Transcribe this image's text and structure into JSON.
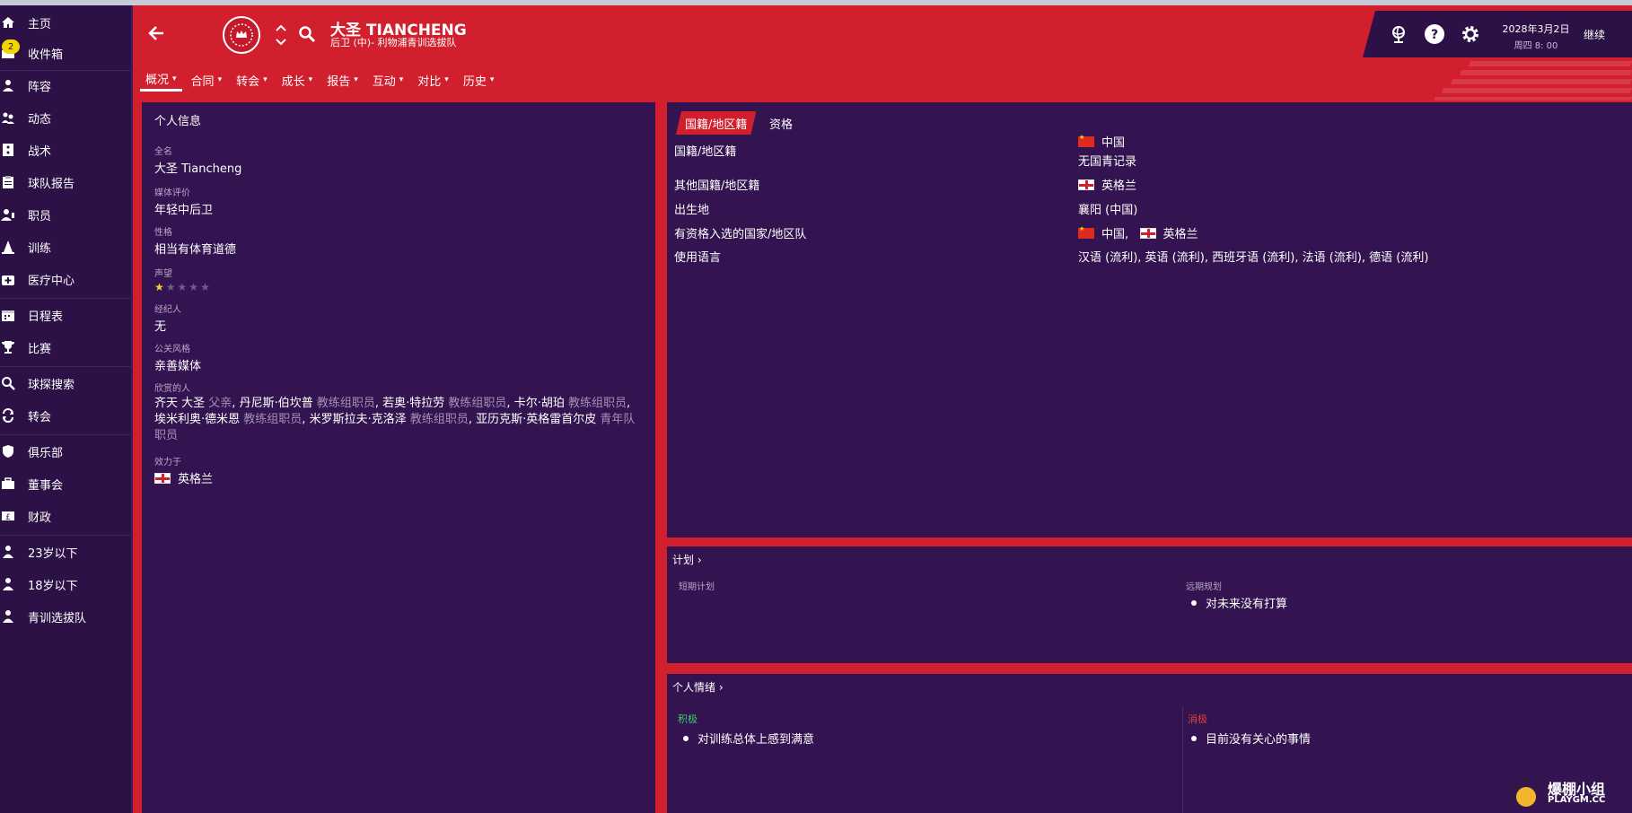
{
  "sidebar": {
    "items": [
      {
        "label": "主页",
        "icon": "home-icon"
      },
      {
        "label": "收件箱",
        "icon": "inbox-icon",
        "badge": "2"
      },
      {
        "label": "阵容",
        "icon": "squad-icon"
      },
      {
        "label": "动态",
        "icon": "dynamics-icon"
      },
      {
        "label": "战术",
        "icon": "tactics-icon"
      },
      {
        "label": "球队报告",
        "icon": "clipboard-icon"
      },
      {
        "label": "职员",
        "icon": "staff-icon"
      },
      {
        "label": "训练",
        "icon": "training-cone-icon"
      },
      {
        "label": "医疗中心",
        "icon": "medical-icon"
      },
      {
        "label": "日程表",
        "icon": "calendar-icon"
      },
      {
        "label": "比赛",
        "icon": "trophy-icon"
      },
      {
        "label": "球探搜索",
        "icon": "scout-search-icon"
      },
      {
        "label": "转会",
        "icon": "transfer-icon"
      },
      {
        "label": "俱乐部",
        "icon": "shield-icon"
      },
      {
        "label": "董事会",
        "icon": "briefcase-icon"
      },
      {
        "label": "财政",
        "icon": "finance-icon"
      },
      {
        "label": "23岁以下",
        "icon": "u23-icon"
      },
      {
        "label": "18岁以下",
        "icon": "u18-icon"
      },
      {
        "label": "青训选拔队",
        "icon": "youth-icon"
      }
    ]
  },
  "header": {
    "player_name": "大圣 TIANCHENG",
    "player_sub": "后卫 (中)- 利物浦青训选拔队",
    "tabs": [
      "概况",
      "合同",
      "转会",
      "成长",
      "报告",
      "互动",
      "对比",
      "历史"
    ],
    "date": "2028年3月2日",
    "time": "周四 8: 00",
    "continue": "继续"
  },
  "personal": {
    "title": "个人信息",
    "full_name_label": "全名",
    "full_name": "大圣 Tiancheng",
    "media_label": "媒体评价",
    "media": "年轻中后卫",
    "personality_label": "性格",
    "personality": "相当有体育道德",
    "reputation_label": "声望",
    "reputation_stars": 0.5,
    "agent_label": "经纪人",
    "agent": "无",
    "pr_label": "公关风格",
    "pr": "亲善媒体",
    "favoured_label": "欣赏的人",
    "favoured": [
      {
        "name": "齐天 大圣",
        "role": "父亲"
      },
      {
        "name": "丹尼斯·伯坎普",
        "role": "教练组职员"
      },
      {
        "name": "若奥·特拉劳",
        "role": "教练组职员"
      },
      {
        "name": "卡尔·胡珀",
        "role": "教练组职员"
      },
      {
        "name": "埃米利奥·德米恩",
        "role": "教练组职员"
      },
      {
        "name": "米罗斯拉夫·克洛泽",
        "role": "教练组职员"
      },
      {
        "name": "亚历克斯·英格雷首尔皮",
        "role": "青年队职员"
      }
    ],
    "plays_for_label": "效力于",
    "plays_for": "英格兰"
  },
  "nationality": {
    "tab_active": "国籍/地区籍",
    "tab_other": "资格",
    "rows": {
      "nat_label": "国籍/地区籍",
      "nat_value": "中国",
      "nat_note": "无国青记录",
      "other_label": "其他国籍/地区籍",
      "other_value": "英格兰",
      "birth_label": "出生地",
      "birth_value": "襄阳 (中国)",
      "eligible_label": "有资格入选的国家/地区队",
      "eligible_1": "中国,",
      "eligible_2": "英格兰",
      "lang_label": "使用语言",
      "lang_value": "汉语 (流利), 英语 (流利), 西班牙语 (流利), 法语 (流利), 德语 (流利)"
    }
  },
  "plans": {
    "title": "计划",
    "short_label": "短期计划",
    "long_label": "远期规划",
    "long_item": "对未来没有打算"
  },
  "mood": {
    "title": "个人情绪",
    "positive_label": "积极",
    "positive_item": "对训练总体上感到满意",
    "negative_label": "消极",
    "negative_item": "目前没有关心的事情"
  },
  "watermark": {
    "text": "爆棚小组",
    "sub": "PLAYGM.CC"
  },
  "colors": {
    "accent": "#d11f2e",
    "panel": "#331451",
    "positive": "#3ad06a",
    "negative": "#e0443a"
  }
}
